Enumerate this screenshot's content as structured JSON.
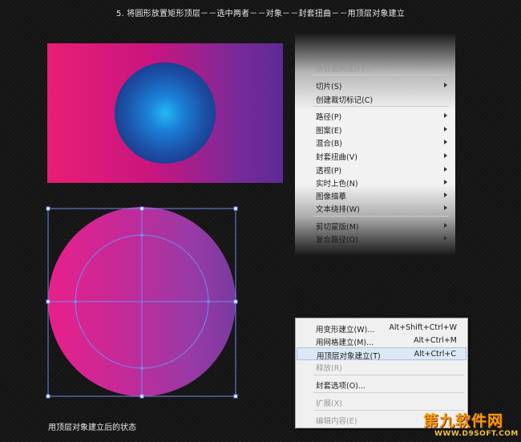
{
  "header": {
    "caption": "5. 将圆形放置矩形顶层－－选中两者－－对象－－封套扭曲－－用顶层对象建立"
  },
  "footer": {
    "caption": "用顶层对象建立后的状态"
  },
  "context_menu": {
    "items": [
      {
        "label": "拼合透明度(F)...",
        "dim": true,
        "submenu": false
      },
      {
        "label": "切片(S)",
        "dim": false,
        "submenu": true
      },
      {
        "label": "创建裁切标记(C)",
        "dim": false,
        "submenu": false
      },
      {
        "label": "路径(P)",
        "dim": false,
        "submenu": true
      },
      {
        "label": "图案(E)",
        "dim": false,
        "submenu": true
      },
      {
        "label": "混合(B)",
        "dim": false,
        "submenu": true
      },
      {
        "label": "封套扭曲(V)",
        "dim": false,
        "submenu": true
      },
      {
        "label": "透视(P)",
        "dim": false,
        "submenu": true
      },
      {
        "label": "实时上色(N)",
        "dim": false,
        "submenu": true
      },
      {
        "label": "图像描摹",
        "dim": false,
        "submenu": true
      },
      {
        "label": "文本绕排(W)",
        "dim": false,
        "submenu": true
      },
      {
        "label": "剪切蒙版(M)",
        "dim": false,
        "submenu": true
      },
      {
        "label": "复合路径(O)",
        "dim": false,
        "submenu": true
      }
    ]
  },
  "submenu": {
    "items": [
      {
        "label": "用变形建立(W)...",
        "shortcut": "Alt+Shift+Ctrl+W",
        "dim": false,
        "highlight": false
      },
      {
        "label": "用网格建立(M)...",
        "shortcut": "Alt+Ctrl+M",
        "dim": false,
        "highlight": false
      },
      {
        "label": "用顶层对象建立(T)",
        "shortcut": "Alt+Ctrl+C",
        "dim": false,
        "highlight": true
      },
      {
        "label": "释放(R)",
        "shortcut": "",
        "dim": true,
        "highlight": false
      },
      {
        "label": "封套选项(O)...",
        "shortcut": "",
        "dim": false,
        "highlight": false
      },
      {
        "label": "扩展(X)",
        "shortcut": "",
        "dim": true,
        "highlight": false
      },
      {
        "label": "编辑内容(E)",
        "shortcut": "",
        "dim": true,
        "highlight": false
      }
    ]
  },
  "watermark": {
    "main": "第九软件网",
    "sub": "WWW.D9SOFT.COM"
  },
  "colors": {
    "background": "#141414",
    "rect_left": "#e91e74",
    "rect_right": "#5e2a96",
    "circle_center": "#23b8f4",
    "circle_edge": "#1c3a8a",
    "selection": "#6e8cf0",
    "menu_bg": "#f0f0f0",
    "menu_highlight": "#dde8f5"
  }
}
